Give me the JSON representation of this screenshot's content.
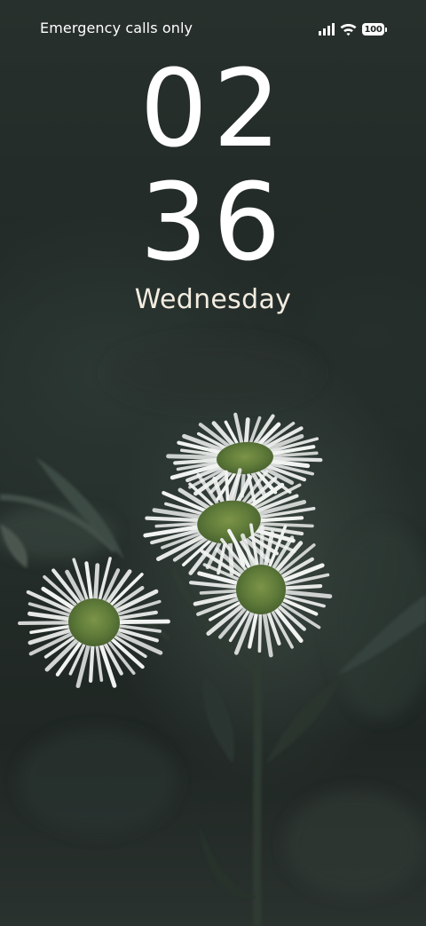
{
  "status_bar": {
    "carrier_text": "Emergency calls only",
    "icons": [
      "signal-icon",
      "wifi-icon",
      "battery-icon"
    ],
    "battery_level": "100"
  },
  "lock_screen": {
    "clock_hours": "02",
    "clock_minutes": "36",
    "day": "Wednesday"
  },
  "wallpaper": {
    "subject": "daisy-flowers",
    "colors": {
      "background": "#222a27",
      "petals": "#f1f3f1",
      "flower_center": "#6f8a3e",
      "stem": "#2f3b34"
    }
  }
}
